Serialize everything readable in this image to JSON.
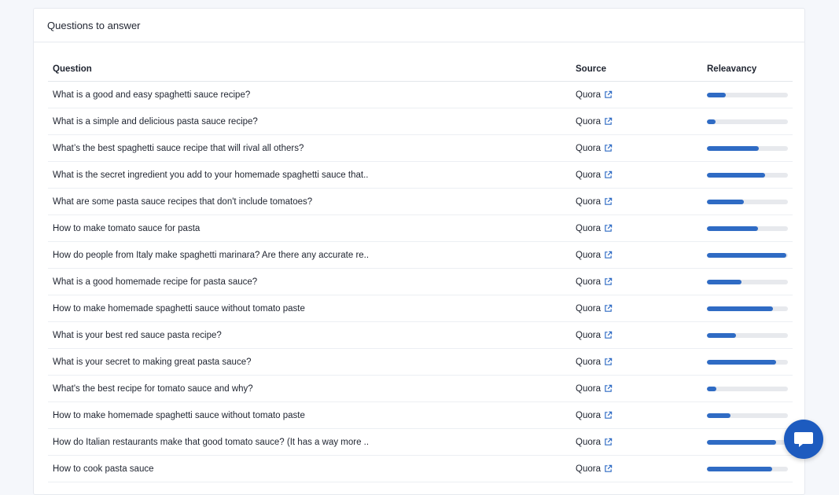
{
  "card": {
    "title": "Questions to answer"
  },
  "table": {
    "headers": {
      "question": "Question",
      "source": "Source",
      "relevancy": "Releavancy"
    },
    "rows": [
      {
        "question": "What is a good and easy spaghetti sauce recipe?",
        "source": "Quora",
        "relevancy": 0.23
      },
      {
        "question": "What is a simple and delicious pasta sauce recipe?",
        "source": "Quora",
        "relevancy": 0.11
      },
      {
        "question": "What’s the best spaghetti sauce recipe that will rival all others?",
        "source": "Quora",
        "relevancy": 0.64
      },
      {
        "question": "What is the secret ingredient you add to your homemade spaghetti sauce that..",
        "source": "Quora",
        "relevancy": 0.72
      },
      {
        "question": "What are some pasta sauce recipes that don't include tomatoes?",
        "source": "Quora",
        "relevancy": 0.46
      },
      {
        "question": "How to make tomato sauce for pasta",
        "source": "Quora",
        "relevancy": 0.63
      },
      {
        "question": "How do people from Italy make spaghetti marinara? Are there any accurate re..",
        "source": "Quora",
        "relevancy": 0.98
      },
      {
        "question": "What is a good homemade recipe for pasta sauce?",
        "source": "Quora",
        "relevancy": 0.43
      },
      {
        "question": "How to make homemade spaghetti sauce without tomato paste",
        "source": "Quora",
        "relevancy": 0.82
      },
      {
        "question": "What is your best red sauce pasta recipe?",
        "source": "Quora",
        "relevancy": 0.36
      },
      {
        "question": "What is your secret to making great pasta sauce?",
        "source": "Quora",
        "relevancy": 0.85
      },
      {
        "question": "What's the best recipe for tomato sauce and why?",
        "source": "Quora",
        "relevancy": 0.12
      },
      {
        "question": "How to make homemade spaghetti sauce without tomato paste",
        "source": "Quora",
        "relevancy": 0.29
      },
      {
        "question": "How do Italian restaurants make that good tomato sauce? (It has a way more ..",
        "source": "Quora",
        "relevancy": 0.85
      },
      {
        "question": "How to cook pasta sauce",
        "source": "Quora",
        "relevancy": 0.81
      }
    ]
  },
  "icons": {
    "external": "external-link-icon",
    "chat": "chat-icon"
  },
  "colors": {
    "accent": "#2f6bc4",
    "chat": "#1d5bbf",
    "track": "#e7e9ed"
  }
}
